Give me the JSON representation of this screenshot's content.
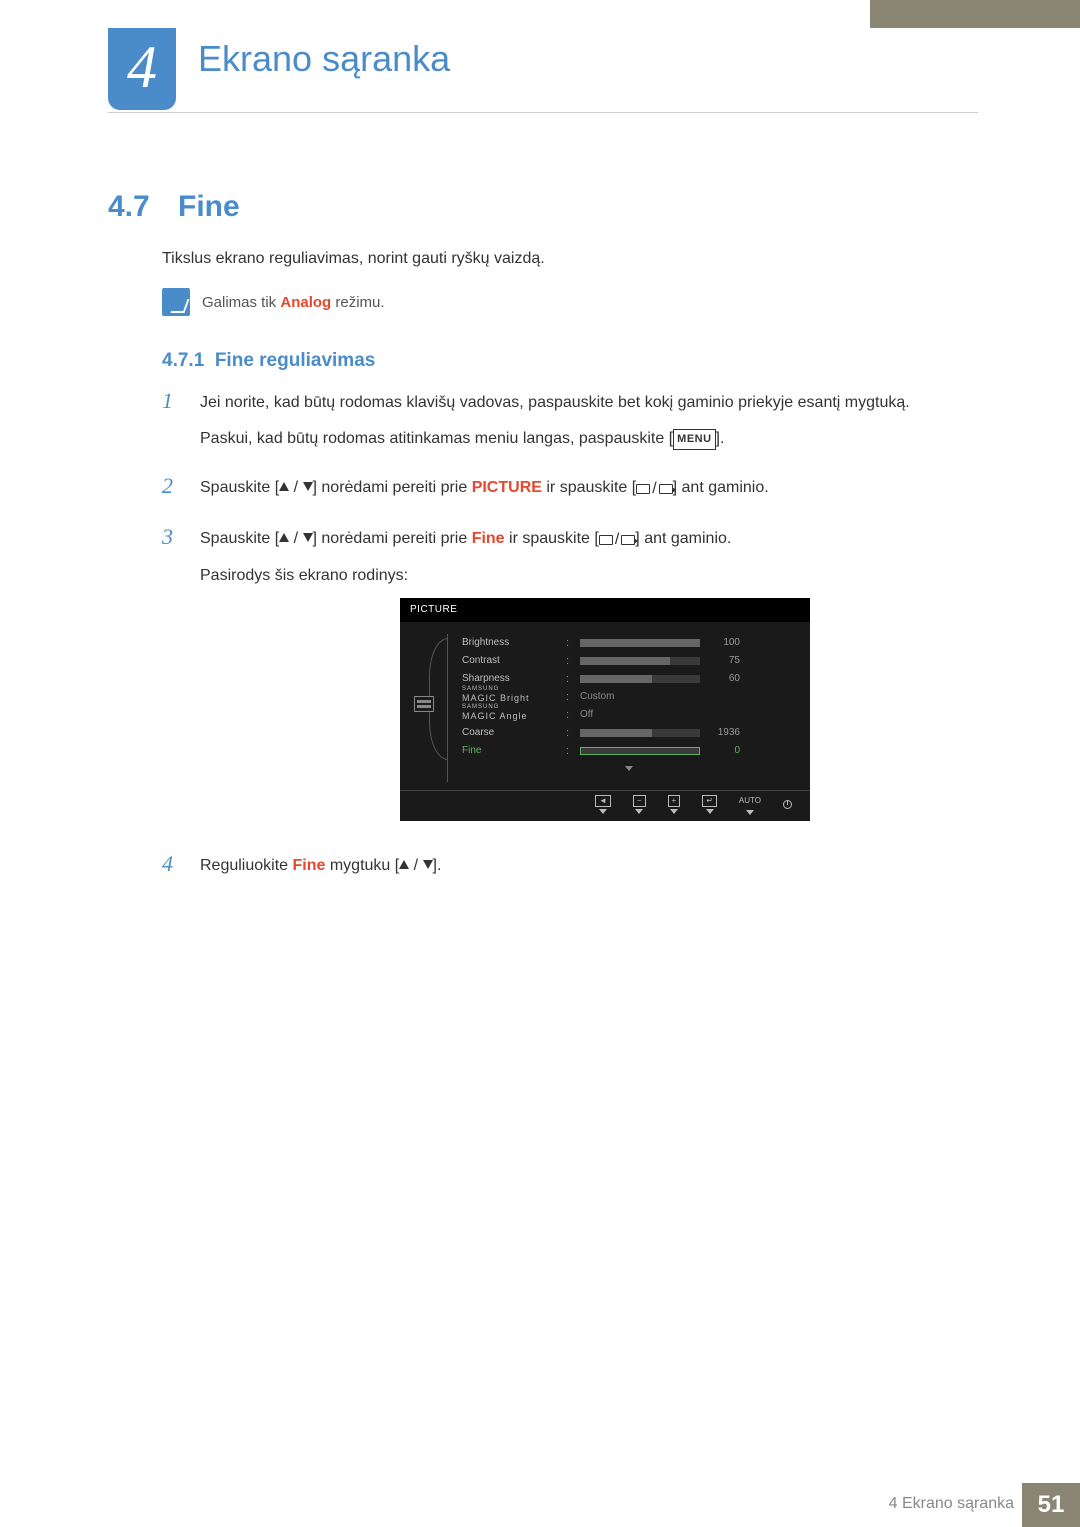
{
  "chapter": {
    "number": "4",
    "title": "Ekrano sąranka"
  },
  "section": {
    "number": "4.7",
    "title": "Fine"
  },
  "intro": "Tikslus ekrano reguliavimas, norint gauti ryškų vaizdą.",
  "note": {
    "prefix": "Galimas tik ",
    "hl": "Analog",
    "suffix": " režimu."
  },
  "subsection": {
    "number": "4.7.1",
    "title": "Fine reguliavimas"
  },
  "steps": {
    "s1a": "Jei norite, kad būtų rodomas klavišų vadovas, paspauskite bet kokį gaminio priekyje esantį mygtuką.",
    "s1b_pre": "Paskui, kad būtų rodomas atitinkamas meniu langas, paspauskite [",
    "s1b_menu": "MENU",
    "s1b_post": "].",
    "s2_pre": "Spauskite [",
    "s2_mid": "] norėdami pereiti prie ",
    "s2_hl": "PICTURE",
    "s2_mid2": " ir spauskite [",
    "s2_post": "] ant gaminio.",
    "s3_pre": "Spauskite [",
    "s3_mid": "] norėdami pereiti prie ",
    "s3_hl": "Fine",
    "s3_mid2": " ir spauskite [",
    "s3_post": "] ant gaminio.",
    "s3_tail": "Pasirodys šis ekrano rodinys:",
    "s4_pre": "Reguliuokite ",
    "s4_hl": "Fine",
    "s4_mid": " mygtuku [",
    "s4_post": "]."
  },
  "osd": {
    "header": "PICTURE",
    "rows": {
      "brightness": {
        "label": "Brightness",
        "value": "100",
        "pct": 100
      },
      "contrast": {
        "label": "Contrast",
        "value": "75",
        "pct": 75
      },
      "sharpness": {
        "label": "Sharpness",
        "value": "60",
        "pct": 60
      },
      "magicBright": {
        "sup": "SAMSUNG",
        "label": "MAGIC Bright",
        "value": "Custom"
      },
      "magicAngle": {
        "sup": "SAMSUNG",
        "label": "MAGIC Angle",
        "value": "Off"
      },
      "coarse": {
        "label": "Coarse",
        "value": "1936",
        "pct": 60
      },
      "fine": {
        "label": "Fine",
        "value": "0",
        "pct": 0
      }
    },
    "footer": {
      "back": "◄",
      "minus": "−",
      "plus": "+",
      "enter": "↵",
      "auto": "AUTO"
    }
  },
  "footer": {
    "text": "4 Ekrano sąranka",
    "page": "51"
  }
}
